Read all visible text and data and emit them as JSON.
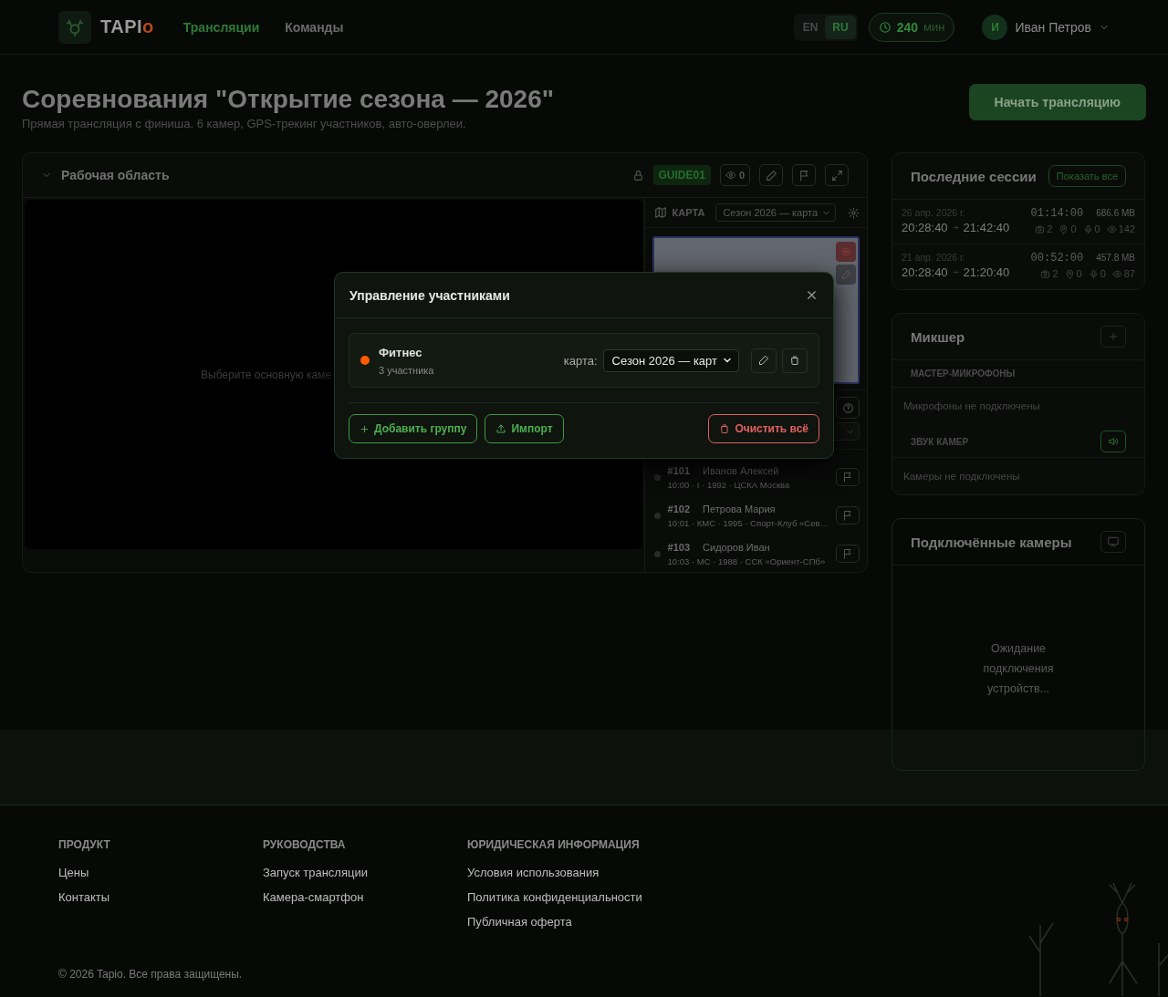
{
  "header": {
    "logo_text": "TAPI",
    "logo_accent": "o",
    "nav": [
      {
        "label": "Трансляции",
        "selected": true
      },
      {
        "label": "Команды",
        "selected": false
      }
    ],
    "languages": [
      {
        "label": "EN",
        "selected": false
      },
      {
        "label": "RU",
        "selected": true
      }
    ],
    "minutes": {
      "value": "240",
      "unit": "мин"
    },
    "user": {
      "initial": "И",
      "name": "Иван Петров"
    }
  },
  "intro": {
    "title": "Соревнования \"Открытие сезона — 2026\"",
    "subtitle": "Прямая трансляция с финиша. 6 камер, GPS-трекинг участников, авто-оверлеи.",
    "start_button": "Начать трансляцию"
  },
  "workspace": {
    "title": "Рабочая область",
    "code": "GUIDE01",
    "viewers": "0",
    "placeholder": "Выберите основную каме",
    "map_label": "КАРТА",
    "map_select": "Сезон 2026 — карта",
    "participants": [
      {
        "number": "#101",
        "name": "Иванов Алексей",
        "details": "10:00 · I · 1992 · ЦСКА Москва"
      },
      {
        "number": "#102",
        "name": "Петрова Мария",
        "details": "10:01 · КМС · 1995 · Спорт-Клуб «Сев…"
      },
      {
        "number": "#103",
        "name": "Сидоров Иван",
        "details": "10:03 · МС · 1988 · ССК «Ориент-СПб»"
      }
    ]
  },
  "sessions": {
    "title": "Последние сессии",
    "show_all": "Показать все",
    "items": [
      {
        "date": "26 апр. 2026 г.",
        "start": "20:28:40",
        "end": "21:42:40",
        "duration": "01:14:00",
        "size": "686.6 MB",
        "cameras": "2",
        "gps": "0",
        "mics": "0",
        "views": "142"
      },
      {
        "date": "21 апр. 2026 г.",
        "start": "20:28:40",
        "end": "21:20:40",
        "duration": "00:52:00",
        "size": "457.8 MB",
        "cameras": "2",
        "gps": "0",
        "mics": "0",
        "views": "87"
      }
    ]
  },
  "mixer": {
    "title": "Микшер",
    "master_label": "МАСТЕР-МИКРОФОНЫ",
    "master_empty": "Микрофоны не подключены",
    "camera_audio_label": "ЗВУК КАМЕР",
    "camera_empty": "Камеры не подключены"
  },
  "cameras": {
    "title": "Подключённые камеры",
    "empty": "Ожидание подключения устройств..."
  },
  "modal": {
    "title": "Управление участниками",
    "groups": [
      {
        "name": "Фитнес",
        "count": "3 участника",
        "color": "#ff5a00",
        "map_label": "карта:",
        "map_value": "Сезон 2026 — карт"
      }
    ],
    "add_group": "Добавить группу",
    "import": "Импорт",
    "clear_all": "Очистить всё"
  },
  "footer": {
    "columns": [
      {
        "title": "ПРОДУКТ",
        "links": [
          "Цены",
          "Контакты"
        ]
      },
      {
        "title": "РУКОВОДСТВА",
        "links": [
          "Запуск трансляции",
          "Камера-смартфон"
        ]
      },
      {
        "title": "ЮРИДИЧЕСКАЯ ИНФОРМАЦИЯ",
        "links": [
          "Условия использования",
          "Политика конфиденциальности",
          "Публичная оферта"
        ]
      }
    ],
    "copyright": "© 2026 Tapio. Все права защищены."
  }
}
